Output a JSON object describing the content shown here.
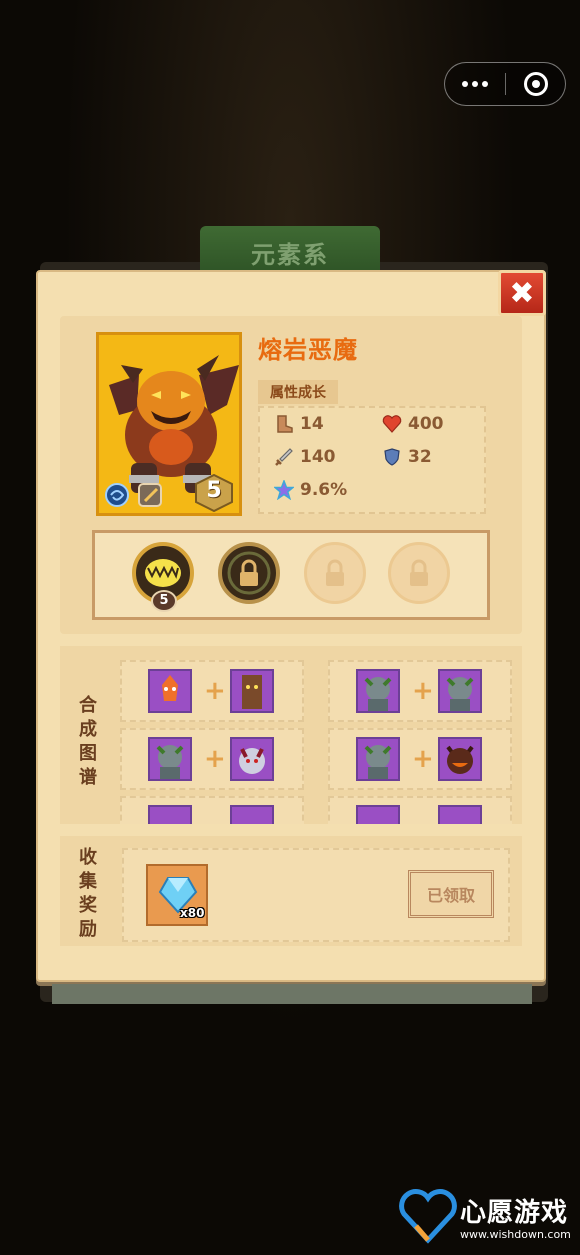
{
  "header": {
    "tab_label": "元素系",
    "close_label": "✖"
  },
  "monster": {
    "name": "熔岩恶魔",
    "star_level": "5",
    "growth_label": "属性成长",
    "stats": {
      "speed": "14",
      "hp": "400",
      "attack": "140",
      "defense": "32",
      "crit": "9.6%"
    }
  },
  "skills": {
    "first_level": "5"
  },
  "recipes": {
    "section_label": [
      "合",
      "成",
      "图",
      "谱"
    ]
  },
  "reward": {
    "section_label": [
      "收",
      "集",
      "奖",
      "励"
    ],
    "item_count": "x80",
    "claimed_label": "已领取"
  },
  "watermark": {
    "brand": "心愿游戏",
    "url": "www.wishdown.com"
  },
  "colors": {
    "parchment": "#f4dfb0",
    "name_orange": "#e86b10",
    "close_red": "#d33a24",
    "portrait_gold": "#f4b815",
    "hero_frame_purple": "#9a4fc4"
  }
}
